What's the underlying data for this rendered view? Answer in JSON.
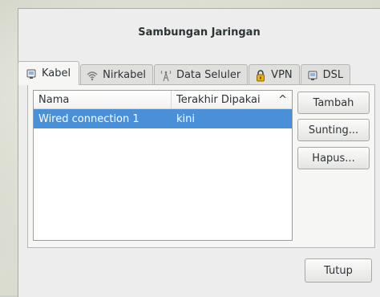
{
  "dialog": {
    "title": "Sambungan Jaringan",
    "close_label": "Tutup"
  },
  "tabs": [
    {
      "label": "Kabel",
      "icon": "ethernet-icon",
      "active": true
    },
    {
      "label": "Nirkabel",
      "icon": "wifi-icon",
      "active": false
    },
    {
      "label": "Data Seluler",
      "icon": "cell-tower-icon",
      "active": false
    },
    {
      "label": "VPN",
      "icon": "lock-icon",
      "active": false
    },
    {
      "label": "DSL",
      "icon": "dsl-icon",
      "active": false
    }
  ],
  "table": {
    "columns": [
      "Nama",
      "Terakhir Dipakai"
    ],
    "sort_indicator": "^",
    "rows": [
      {
        "name": "Wired connection 1",
        "last_used": "kini",
        "selected": true
      }
    ]
  },
  "actions": {
    "add_label": "Tambah",
    "edit_label": "Sunting...",
    "delete_label": "Hapus..."
  },
  "colors": {
    "selection": "#4a90d9",
    "window_bg": "#ededed"
  }
}
